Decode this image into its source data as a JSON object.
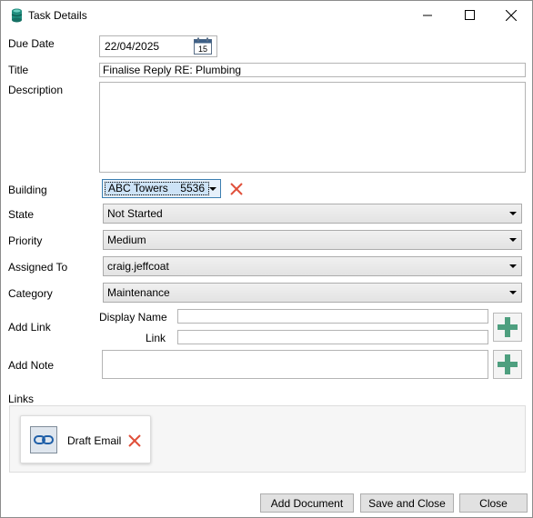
{
  "window": {
    "title": "Task Details"
  },
  "labels": {
    "due_date": "Due Date",
    "title": "Title",
    "description": "Description",
    "building": "Building",
    "state": "State",
    "priority": "Priority",
    "assigned_to": "Assigned To",
    "category": "Category",
    "add_link": "Add Link",
    "display_name": "Display Name",
    "link": "Link",
    "add_note": "Add Note",
    "links": "Links"
  },
  "fields": {
    "due_date": "22/04/2025",
    "calendar_day": "15",
    "title": "Finalise Reply RE: Plumbing",
    "description": "",
    "building_name": "ABC Towers",
    "building_code": "5536",
    "state": "Not Started",
    "priority": "Medium",
    "assigned_to": "craig.jeffcoat",
    "category": "Maintenance",
    "display_name": "",
    "link": "",
    "note": ""
  },
  "links": [
    {
      "label": "Draft Email",
      "icon": "chain-link-icon"
    }
  ],
  "buttons": {
    "add_document": "Add Document",
    "save_and_close": "Save and Close",
    "close": "Close"
  },
  "colors": {
    "delete_x": "#e0503a",
    "plus": "#4e9f7f",
    "selection": "#cde3f7"
  }
}
